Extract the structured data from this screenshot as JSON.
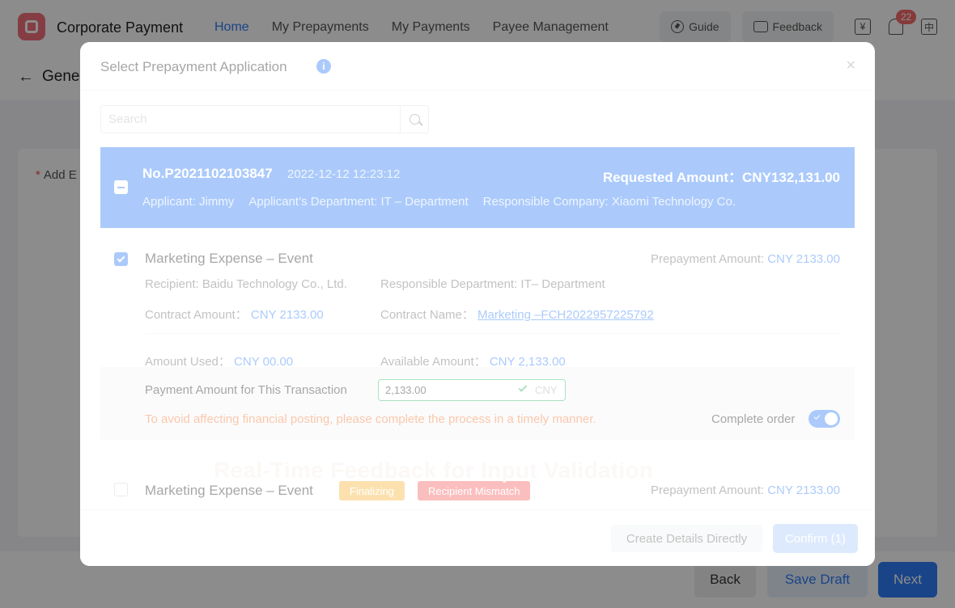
{
  "app": {
    "title": "Corporate Payment",
    "nav": [
      "Home",
      "My Prepayments",
      "My Payments",
      "Payee Management"
    ],
    "active_nav": "Home",
    "guide_label": "Guide",
    "feedback_label": "Feedback",
    "notification_count": "22",
    "currency_icon_label": "¥",
    "lang_icon_label": "中",
    "page_title_partial": "Gene",
    "add_label_partial": "Add E",
    "required_mark": "*",
    "back_label": "Back",
    "save_draft_label": "Save Draft",
    "next_label": "Next",
    "back_arrow": "←"
  },
  "modal": {
    "title": "Select Prepayment Application",
    "info_icon_glyph": "i",
    "close_glyph": "×",
    "search_placeholder": "Search",
    "application": {
      "number": "No.P2021102103847",
      "date": "2022-12-12 12:23:12",
      "requested_amount": "Requested Amount：CNY132,131.00",
      "applicant": "Applicant: Jimmy",
      "department": "Applicant’s Department: IT – Department",
      "company": "Responsible Company: Xiaomi Technology Co."
    },
    "item": {
      "title": "Marketing Expense – Event",
      "prepay_label": "Prepayment Amount: ",
      "prepay_value": "CNY 2133.00",
      "recipient": "Recipient:  Baidu Technology Co., Ltd.",
      "resp_department": "Responsible Department:  IT– Department",
      "contract_amount_label": "Contract Amount： ",
      "contract_amount_value": "CNY 2133.00",
      "contract_name_label": "Contract Name： ",
      "contract_name_value": "Marketing –FCH2022957225792",
      "amount_used_label": "Amount Used： ",
      "amount_used_value": "CNY 00.00",
      "available_label": "Available Amount： ",
      "available_value": "CNY 2,133.00",
      "payment_label": "Payment Amount for This Transaction",
      "payment_value": "2,133.00",
      "payment_currency": "CNY",
      "warning": "To avoid affecting financial posting, please complete the process in a timely manner.",
      "complete_label": "Complete order",
      "complete_on": true
    },
    "item2": {
      "title": "Marketing Expense – Event",
      "tag_finalizing": "Finalizing",
      "tag_mismatch": "Recipient Mismatch",
      "prepay_label": "Prepayment Amount: ",
      "prepay_value": "CNY 2133.00"
    },
    "create_label": "Create Details Directly",
    "confirm_label": "Confirm (1)"
  },
  "overlay_caption": "Real-Time Feedback for Input Validation",
  "pointer_glyph": "👇",
  "colors": {
    "accent": "#2f7cf6",
    "success": "#2fb35a",
    "warning": "#f4742b",
    "tag_yellow": "#f7b538",
    "tag_red": "#f45e5e",
    "brand_logo": "#f2707d"
  }
}
